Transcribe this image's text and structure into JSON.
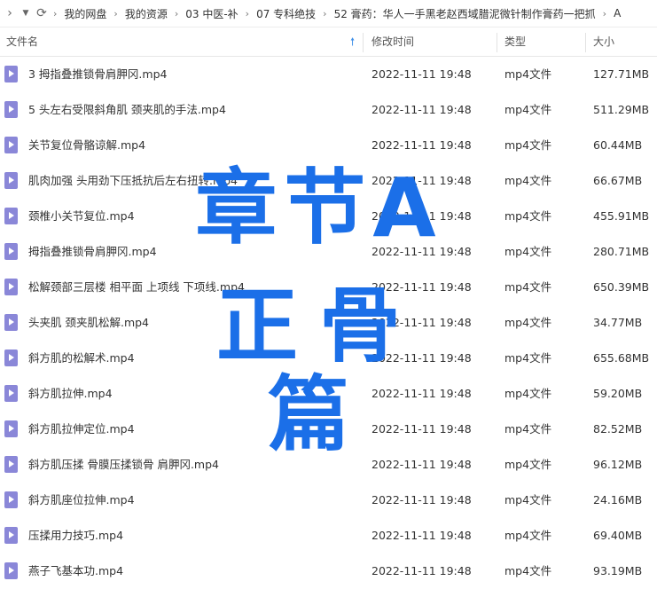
{
  "breadcrumb": [
    "我的网盘",
    "我的资源",
    "03 中医-补",
    "07 专科绝技",
    "52 膏药：华人一手黑老赵西域腊泥微针制作膏药一把抓",
    "A"
  ],
  "columns": {
    "name": "文件名",
    "time": "修改时间",
    "type": "类型",
    "size": "大小"
  },
  "files": [
    {
      "name": "3 拇指叠推锁骨肩胛冈.mp4",
      "time": "2022-11-11 19:48",
      "type": "mp4文件",
      "size": "127.71MB"
    },
    {
      "name": "5  头左右受限斜角肌 颈夹肌的手法.mp4",
      "time": "2022-11-11 19:48",
      "type": "mp4文件",
      "size": "511.29MB"
    },
    {
      "name": "关节复位骨骼谅解.mp4",
      "time": "2022-11-11 19:48",
      "type": "mp4文件",
      "size": "60.44MB"
    },
    {
      "name": "肌肉加强  头用劲下压抵抗后左右扭转.mp4",
      "time": "2022-11-11 19:48",
      "type": "mp4文件",
      "size": "66.67MB"
    },
    {
      "name": "颈椎小关节复位.mp4",
      "time": "2022-11-11 19:48",
      "type": "mp4文件",
      "size": "455.91MB"
    },
    {
      "name": "拇指叠推锁骨肩胛冈.mp4",
      "time": "2022-11-11 19:48",
      "type": "mp4文件",
      "size": "280.71MB"
    },
    {
      "name": "松解颈部三层楼 相平面 上项线 下项线.mp4",
      "time": "2022-11-11 19:48",
      "type": "mp4文件",
      "size": "650.39MB"
    },
    {
      "name": "头夹肌 颈夹肌松解.mp4",
      "time": "2022-11-11 19:48",
      "type": "mp4文件",
      "size": "34.77MB"
    },
    {
      "name": "斜方肌的松解术.mp4",
      "time": "2022-11-11 19:48",
      "type": "mp4文件",
      "size": "655.68MB"
    },
    {
      "name": "斜方肌拉伸.mp4",
      "time": "2022-11-11 19:48",
      "type": "mp4文件",
      "size": "59.20MB"
    },
    {
      "name": "斜方肌拉伸定位.mp4",
      "time": "2022-11-11 19:48",
      "type": "mp4文件",
      "size": "82.52MB"
    },
    {
      "name": "斜方肌压揉  骨膜压揉锁骨 肩胛冈.mp4",
      "time": "2022-11-11 19:48",
      "type": "mp4文件",
      "size": "96.12MB"
    },
    {
      "name": "斜方肌座位拉伸.mp4",
      "time": "2022-11-11 19:48",
      "type": "mp4文件",
      "size": "24.16MB"
    },
    {
      "name": "压揉用力技巧.mp4",
      "time": "2022-11-11 19:48",
      "type": "mp4文件",
      "size": "69.40MB"
    },
    {
      "name": "燕子飞基本功.mp4",
      "time": "2022-11-11 19:48",
      "type": "mp4文件",
      "size": "93.19MB"
    }
  ],
  "watermark": {
    "line1": "章节A",
    "line2": "正骨篇"
  },
  "colors": {
    "accent": "#1b6fe8",
    "file_icon": "#8a87d8",
    "sort": "#3d8ee8"
  }
}
